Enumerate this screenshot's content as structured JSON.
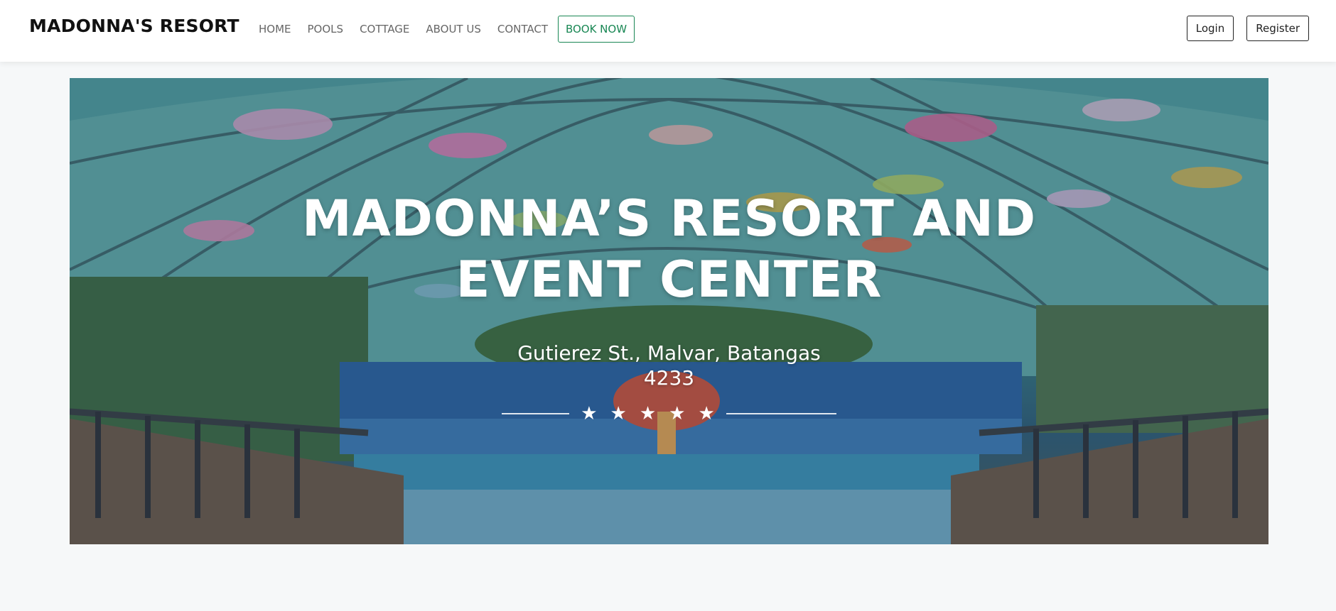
{
  "navbar": {
    "brand": "MADONNA'S RESORT",
    "links": [
      {
        "label": "HOME"
      },
      {
        "label": "POOLS"
      },
      {
        "label": "COTTAGE"
      },
      {
        "label": "ABOUT US"
      },
      {
        "label": "CONTACT"
      }
    ],
    "book_now": "BOOK NOW",
    "login": "Login",
    "register": "Register",
    "accent_color": "#198754"
  },
  "hero": {
    "title_line1": "MADONNA’S RESORT AND",
    "title_line2": "EVENT CENTER",
    "address_line1": "Gutierez St., Malvar, Batangas",
    "address_line2": "4233",
    "rating": 5,
    "star_glyph": "★",
    "background_image": "pool-umbrella-canopy-photo"
  }
}
